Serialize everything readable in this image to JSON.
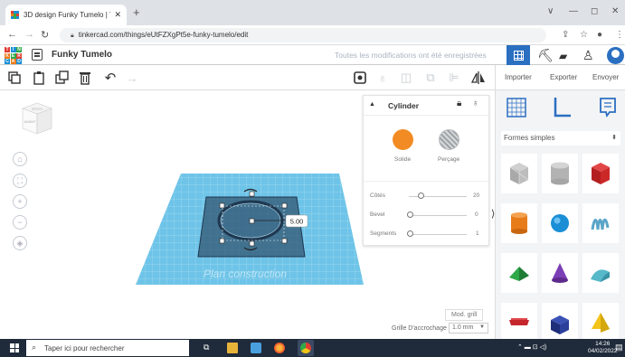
{
  "browser": {
    "tab_title": "3D design Funky Tumelo | Tinke",
    "tab_close": "✕",
    "new_tab": "+",
    "url": "tinkercad.com/things/eUtFZXgPt5e-funky-tumelo/edit",
    "window_minimize": "∨",
    "window_min": "—",
    "window_max": "◻",
    "window_close": "✕"
  },
  "app": {
    "logo_letters": [
      "T",
      "I",
      "N",
      "K",
      "E",
      "R",
      "C",
      "A",
      "D"
    ],
    "project_name": "Funky Tumelo",
    "save_status": "Toutes les modifications ont été enregistrées"
  },
  "toolbar": {
    "import_label": "Importer",
    "export_label": "Exporter",
    "send_label": "Envoyer"
  },
  "viewcube": {
    "top_label": "DESSUS",
    "front_label": "AVANT"
  },
  "workplane": {
    "label": "Plan construction",
    "dimension_value": "5.00",
    "edit_grid_label": "Mod. grill",
    "snap_label": "Grille D'accrochage",
    "snap_value": "1.0 mm"
  },
  "properties": {
    "shape_name": "Cylinder",
    "solid_label": "Solide",
    "hole_label": "Perçage",
    "params": [
      {
        "label": "Côtés",
        "value": "20",
        "level": 0.2
      },
      {
        "label": "Bevel",
        "value": "0",
        "level": 0.0
      },
      {
        "label": "Segments",
        "value": "1",
        "level": 0.0
      }
    ],
    "solid_color": "#f28b24"
  },
  "shapes_panel": {
    "category": "Formes simples",
    "shapes": [
      {
        "name": "box-hole-icon",
        "color": "#b8b8b8"
      },
      {
        "name": "cylinder-hole-icon",
        "color": "#b8b8b8"
      },
      {
        "name": "box-icon",
        "color": "#d42a2a"
      },
      {
        "name": "cylinder-icon",
        "color": "#e87c1a"
      },
      {
        "name": "sphere-icon",
        "color": "#1a8fd6"
      },
      {
        "name": "scribble-icon",
        "color": "#5aa5c8"
      },
      {
        "name": "roof-icon",
        "color": "#2fa84a"
      },
      {
        "name": "cone-icon",
        "color": "#7b3fb5"
      },
      {
        "name": "round-roof-icon",
        "color": "#57b8c9"
      },
      {
        "name": "text-icon",
        "color": "#c4262c"
      },
      {
        "name": "box-blue-icon",
        "color": "#2b3f9c"
      },
      {
        "name": "pyramid-icon",
        "color": "#f2c419"
      }
    ]
  },
  "taskbar": {
    "search_placeholder": "Taper ici pour rechercher",
    "time": "14:26",
    "date": "04/02/2022"
  }
}
